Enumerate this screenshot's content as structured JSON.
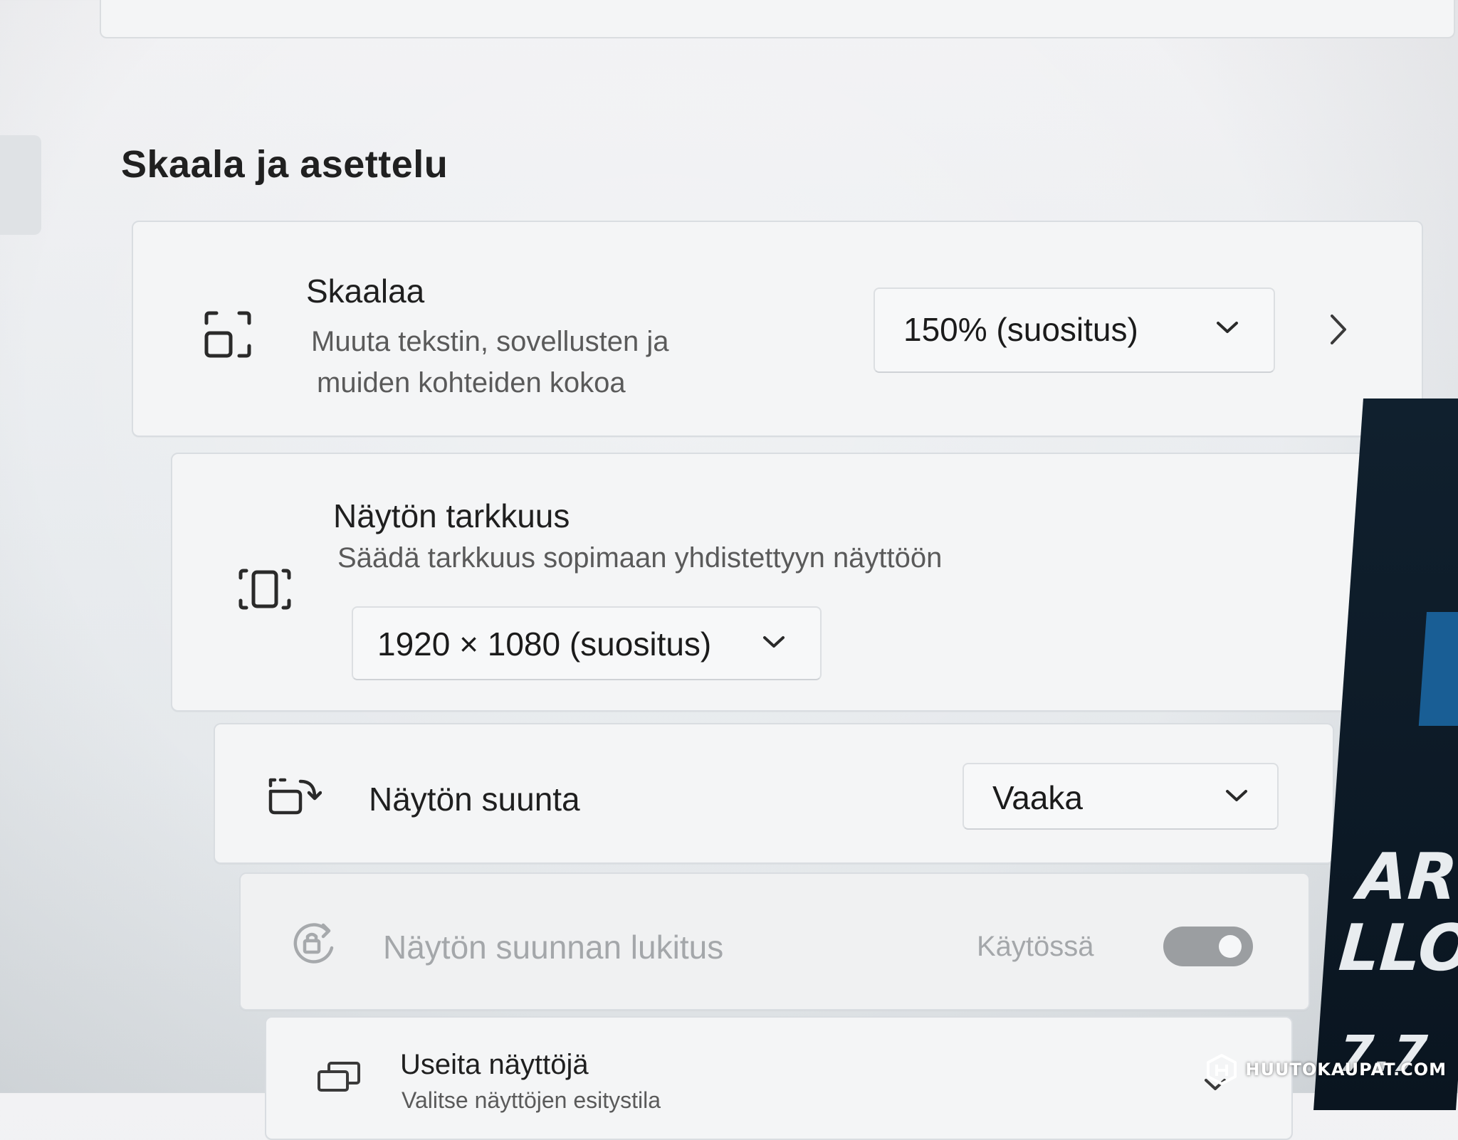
{
  "section": {
    "title": "Skaala ja asettelu"
  },
  "scale": {
    "title": "Skaalaa",
    "description_line1": "Muuta tekstin, sovellusten ja",
    "description_line2": "muiden kohteiden kokoa",
    "value": "150% (suositus)",
    "icon": "scale-icon",
    "chevron": "chevron-right-icon"
  },
  "resolution": {
    "title": "Näytön tarkkuus",
    "description": "Säädä tarkkuus sopimaan yhdistettyyn näyttöön",
    "value": "1920 × 1080 (suositus)",
    "icon": "resolution-icon"
  },
  "orientation": {
    "title": "Näytön suunta",
    "value": "Vaaka",
    "icon": "orientation-icon"
  },
  "rotation_lock": {
    "title": "Näytön suunnan lukitus",
    "state_label": "Käytössä",
    "enabled": true,
    "disabled_row": true,
    "icon": "rotation-lock-icon"
  },
  "multiple_displays": {
    "title": "Useita näyttöjä",
    "description": "Valitse näyttöjen esitystila",
    "icon": "multiple-displays-icon"
  },
  "background_poster": {
    "line1": "AR",
    "line2": "LLO",
    "line3": "7.7"
  },
  "watermark": {
    "text": "HUUTOKAUPAT.COM"
  }
}
